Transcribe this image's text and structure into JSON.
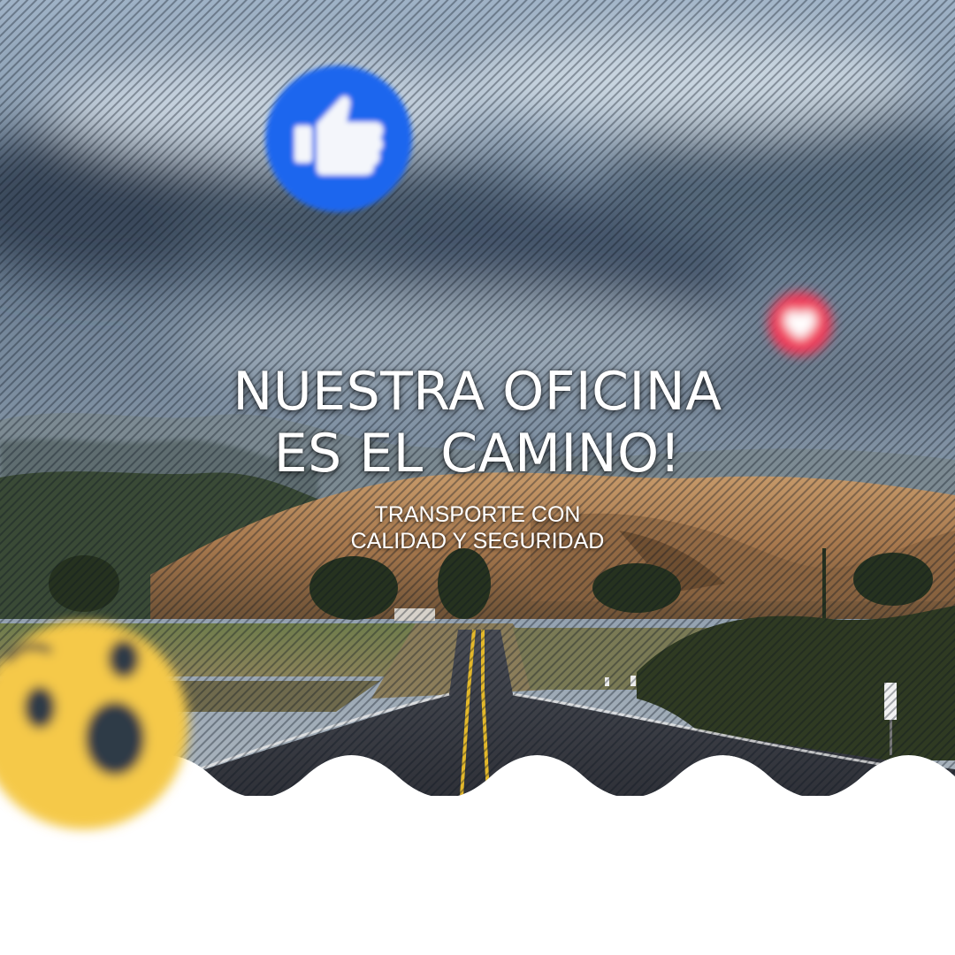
{
  "headline": {
    "line1": "NUESTRA OFICINA",
    "line2": "ES EL CAMINO!"
  },
  "tagline": {
    "line1": "TRANSPORTE CON",
    "line2": "CALIDAD Y SEGURIDAD"
  },
  "icons": {
    "like": "thumbs-up-icon",
    "love": "heart-icon",
    "wow": "wow-face-icon"
  },
  "colors": {
    "like_blue": "#1f66ee",
    "love_red": "#f03a5a",
    "wow_yellow": "#f5c94a",
    "road_line_yellow": "#e4b92b",
    "background_white": "#ffffff"
  }
}
